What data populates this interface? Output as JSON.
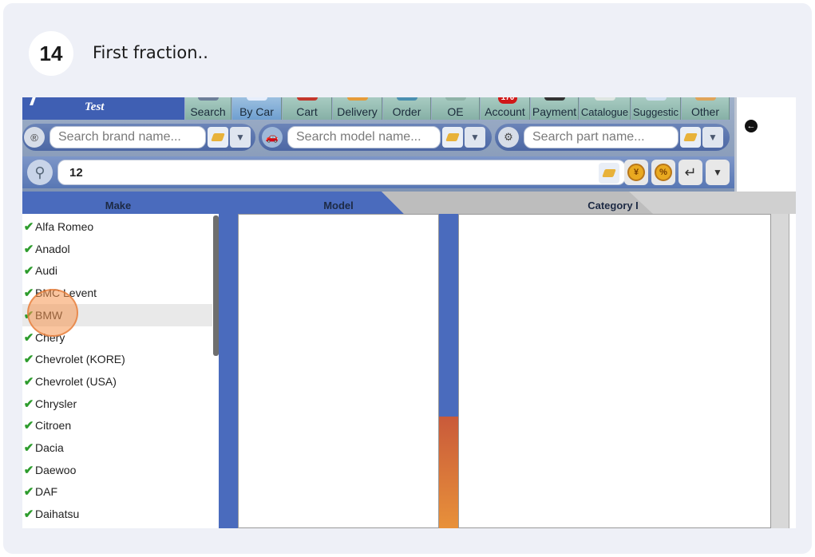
{
  "step": {
    "number": "14",
    "text": "First fraction.."
  },
  "app": {
    "brand": "Test"
  },
  "nav": {
    "tabs": [
      {
        "label": "Search"
      },
      {
        "label": "By Car",
        "active": true
      },
      {
        "label": "Cart"
      },
      {
        "label": "Delivery"
      },
      {
        "label": "Order"
      },
      {
        "label": "OE"
      },
      {
        "label": "Account",
        "badge": "170"
      },
      {
        "label": "Payment"
      },
      {
        "label": "Catalogue"
      },
      {
        "label": "Suggestic"
      },
      {
        "label": "Other"
      }
    ]
  },
  "search": {
    "brand_placeholder": "Search brand name...",
    "model_placeholder": "Search model name...",
    "part_placeholder": "Search part name...",
    "main_value": "12"
  },
  "columns": {
    "make": "Make",
    "model": "Model",
    "category": "Category I"
  },
  "makes": [
    "Alfa Romeo",
    "Anadol",
    "Audi",
    "BMC Levent",
    "BMW",
    "Chery",
    "Chevrolet (KORE)",
    "Chevrolet (USA)",
    "Chrysler",
    "Citroen",
    "Dacia",
    "Daewoo",
    "DAF",
    "Daihatsu"
  ],
  "selected_make": "BMW",
  "colors": {
    "accent_blue": "#4a6bbd",
    "check_green": "#2d9c2d",
    "highlight": "#f59650"
  },
  "icons": {
    "coin": "¥",
    "percent": "%",
    "enter": "↵",
    "back": "←",
    "check": "✔",
    "magnifier": "⚲",
    "dropdown": "▼"
  }
}
